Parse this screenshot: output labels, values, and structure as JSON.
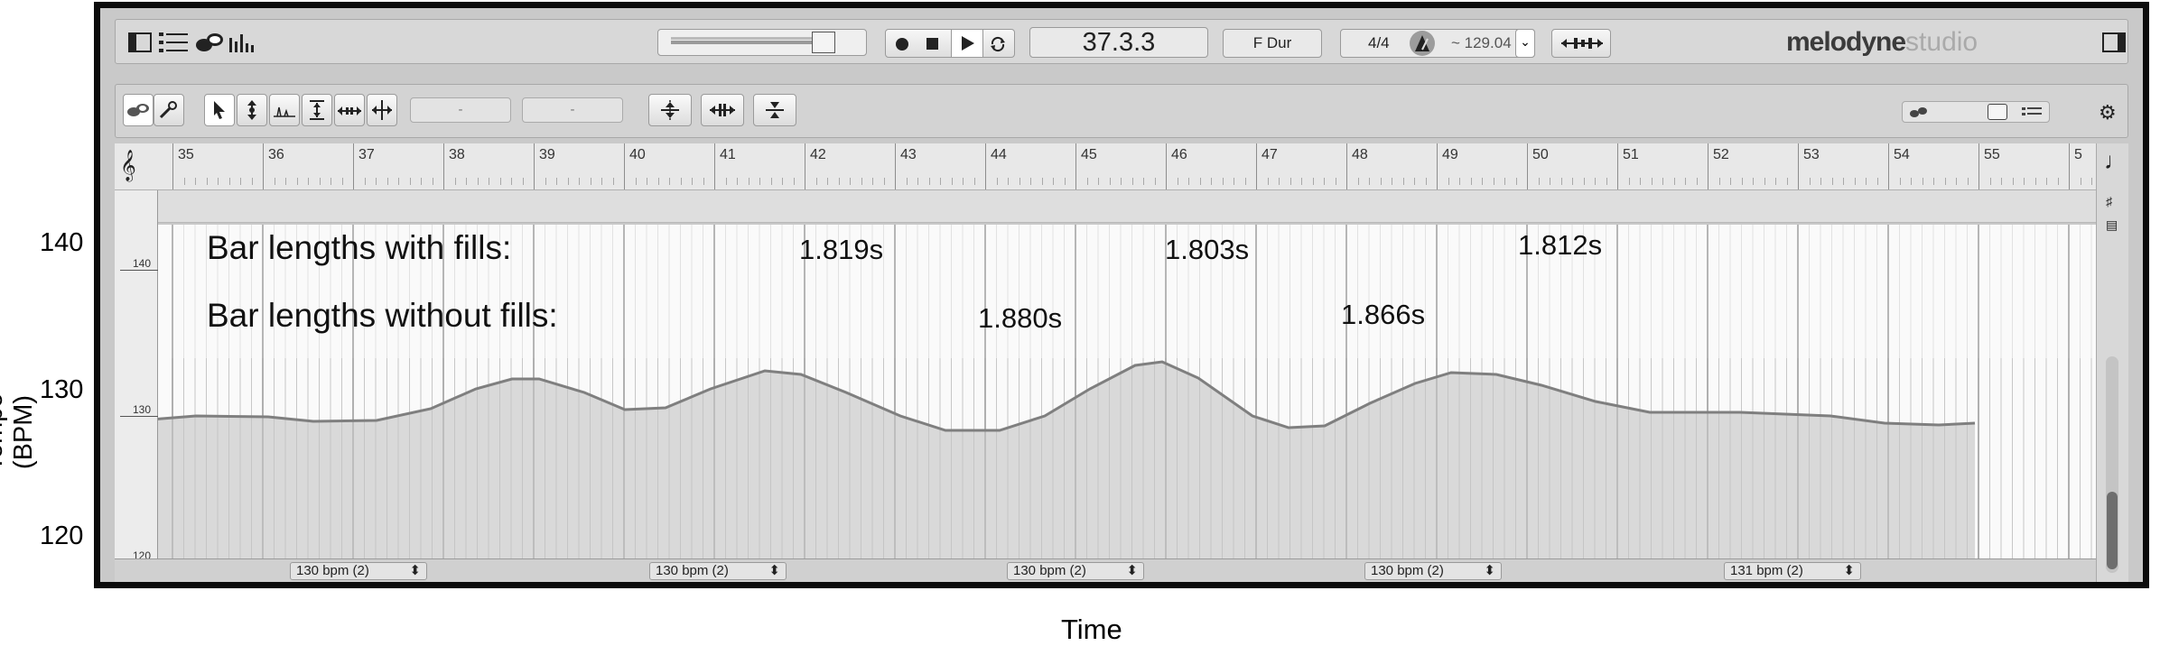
{
  "outer_labels": {
    "y_axis_title": "Tempo (BPM)",
    "x_axis_title": "Time",
    "y_ticks": [
      "140",
      "130",
      "120"
    ]
  },
  "transport": {
    "position": "37.3.3",
    "key": "F Dur",
    "time_signature": "4/4",
    "tempo": "~ 129.04",
    "tempo_dropdown": "⌄"
  },
  "brand": {
    "name": "melodyne",
    "edition": "studio"
  },
  "toolbar": {
    "field_1": "-",
    "field_2": "-"
  },
  "ruler": {
    "bars": [
      "35",
      "36",
      "37",
      "38",
      "39",
      "40",
      "41",
      "42",
      "43",
      "44",
      "45",
      "46",
      "47",
      "48",
      "49",
      "50",
      "51",
      "52",
      "53",
      "54",
      "55",
      "5"
    ]
  },
  "editor": {
    "scale_labels": [
      "140",
      "130",
      "120"
    ],
    "annotation_with_fills": "Bar lengths with fills:",
    "annotation_without_fills": "Bar lengths without fills:",
    "durations_with_fills": [
      "1.819s",
      "1.803s",
      "1.812s"
    ],
    "durations_without_fills": [
      "1.880s",
      "1.866s"
    ]
  },
  "tempo_segments": [
    "130 bpm  (2)",
    "130 bpm  (2)",
    "130 bpm  (2)",
    "130 bpm  (2)",
    "131 bpm  (2)"
  ],
  "colors": {
    "frame": "#0c0c0c",
    "curve": "#7f7f7f",
    "fill": "#d9d9d9",
    "background": "#fafafa"
  }
}
